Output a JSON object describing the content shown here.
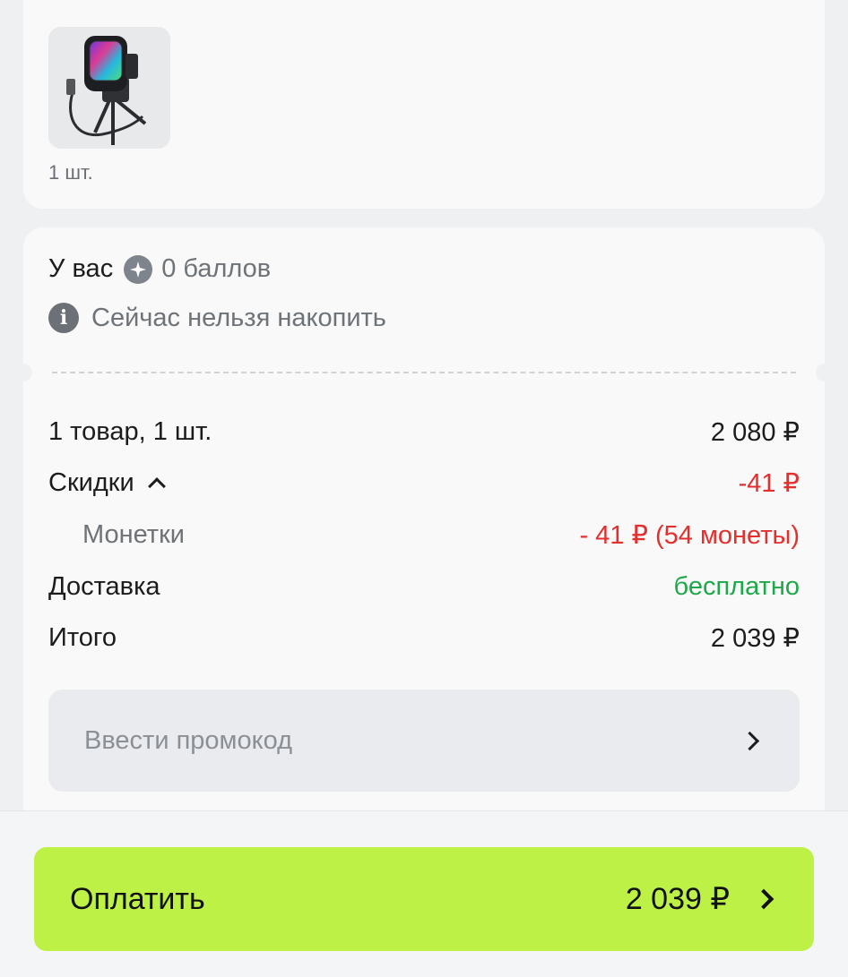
{
  "product": {
    "quantity_label": "1 шт.",
    "image_icon": "microphone-product-image"
  },
  "points": {
    "label": "У вас",
    "value": "0 баллов",
    "icon": "points-coin-icon",
    "info_text": "Сейчас нельзя накопить"
  },
  "summary": {
    "items_label": "1 товар, 1 шт.",
    "items_value": "2 080 ₽",
    "discounts_label": "Скидки",
    "discounts_value": "-41 ₽",
    "coins_label": "Монетки",
    "coins_value": "- 41 ₽ (54 монеты)",
    "delivery_label": "Доставка",
    "delivery_value": "бесплатно",
    "total_label": "Итого",
    "total_value": "2 039 ₽"
  },
  "promo": {
    "placeholder": "Ввести промокод"
  },
  "pay_button": {
    "label": "Оплатить",
    "amount": "2 039 ₽"
  },
  "colors": {
    "accent_green_button": "#bdf146",
    "discount_red": "#e2302f",
    "free_delivery_green": "#1ea84a"
  }
}
